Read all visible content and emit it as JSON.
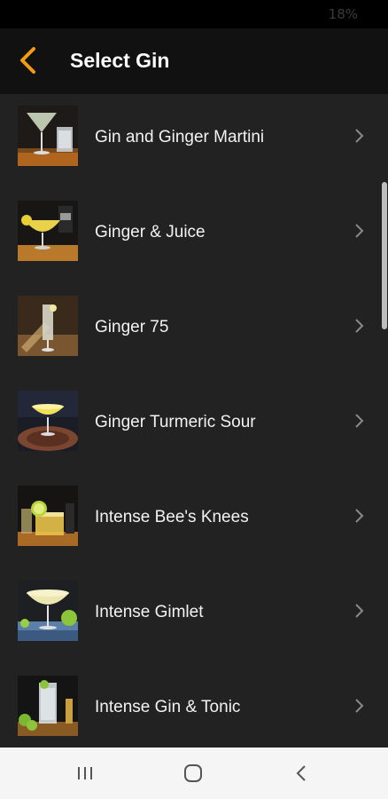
{
  "status": {
    "text": "18%"
  },
  "header": {
    "title": "Select Gin",
    "back_icon": "chevron-left-icon",
    "accent": "#f39c12"
  },
  "items": [
    {
      "label": "Gin and Ginger Martini"
    },
    {
      "label": "Ginger & Juice"
    },
    {
      "label": "Ginger 75"
    },
    {
      "label": "Ginger Turmeric Sour"
    },
    {
      "label": "Intense Bee's Knees"
    },
    {
      "label": "Intense Gimlet"
    },
    {
      "label": "Intense Gin & Tonic"
    }
  ],
  "nav": {
    "recents_icon": "recents-icon",
    "home_icon": "home-icon",
    "back_icon": "back-icon"
  }
}
